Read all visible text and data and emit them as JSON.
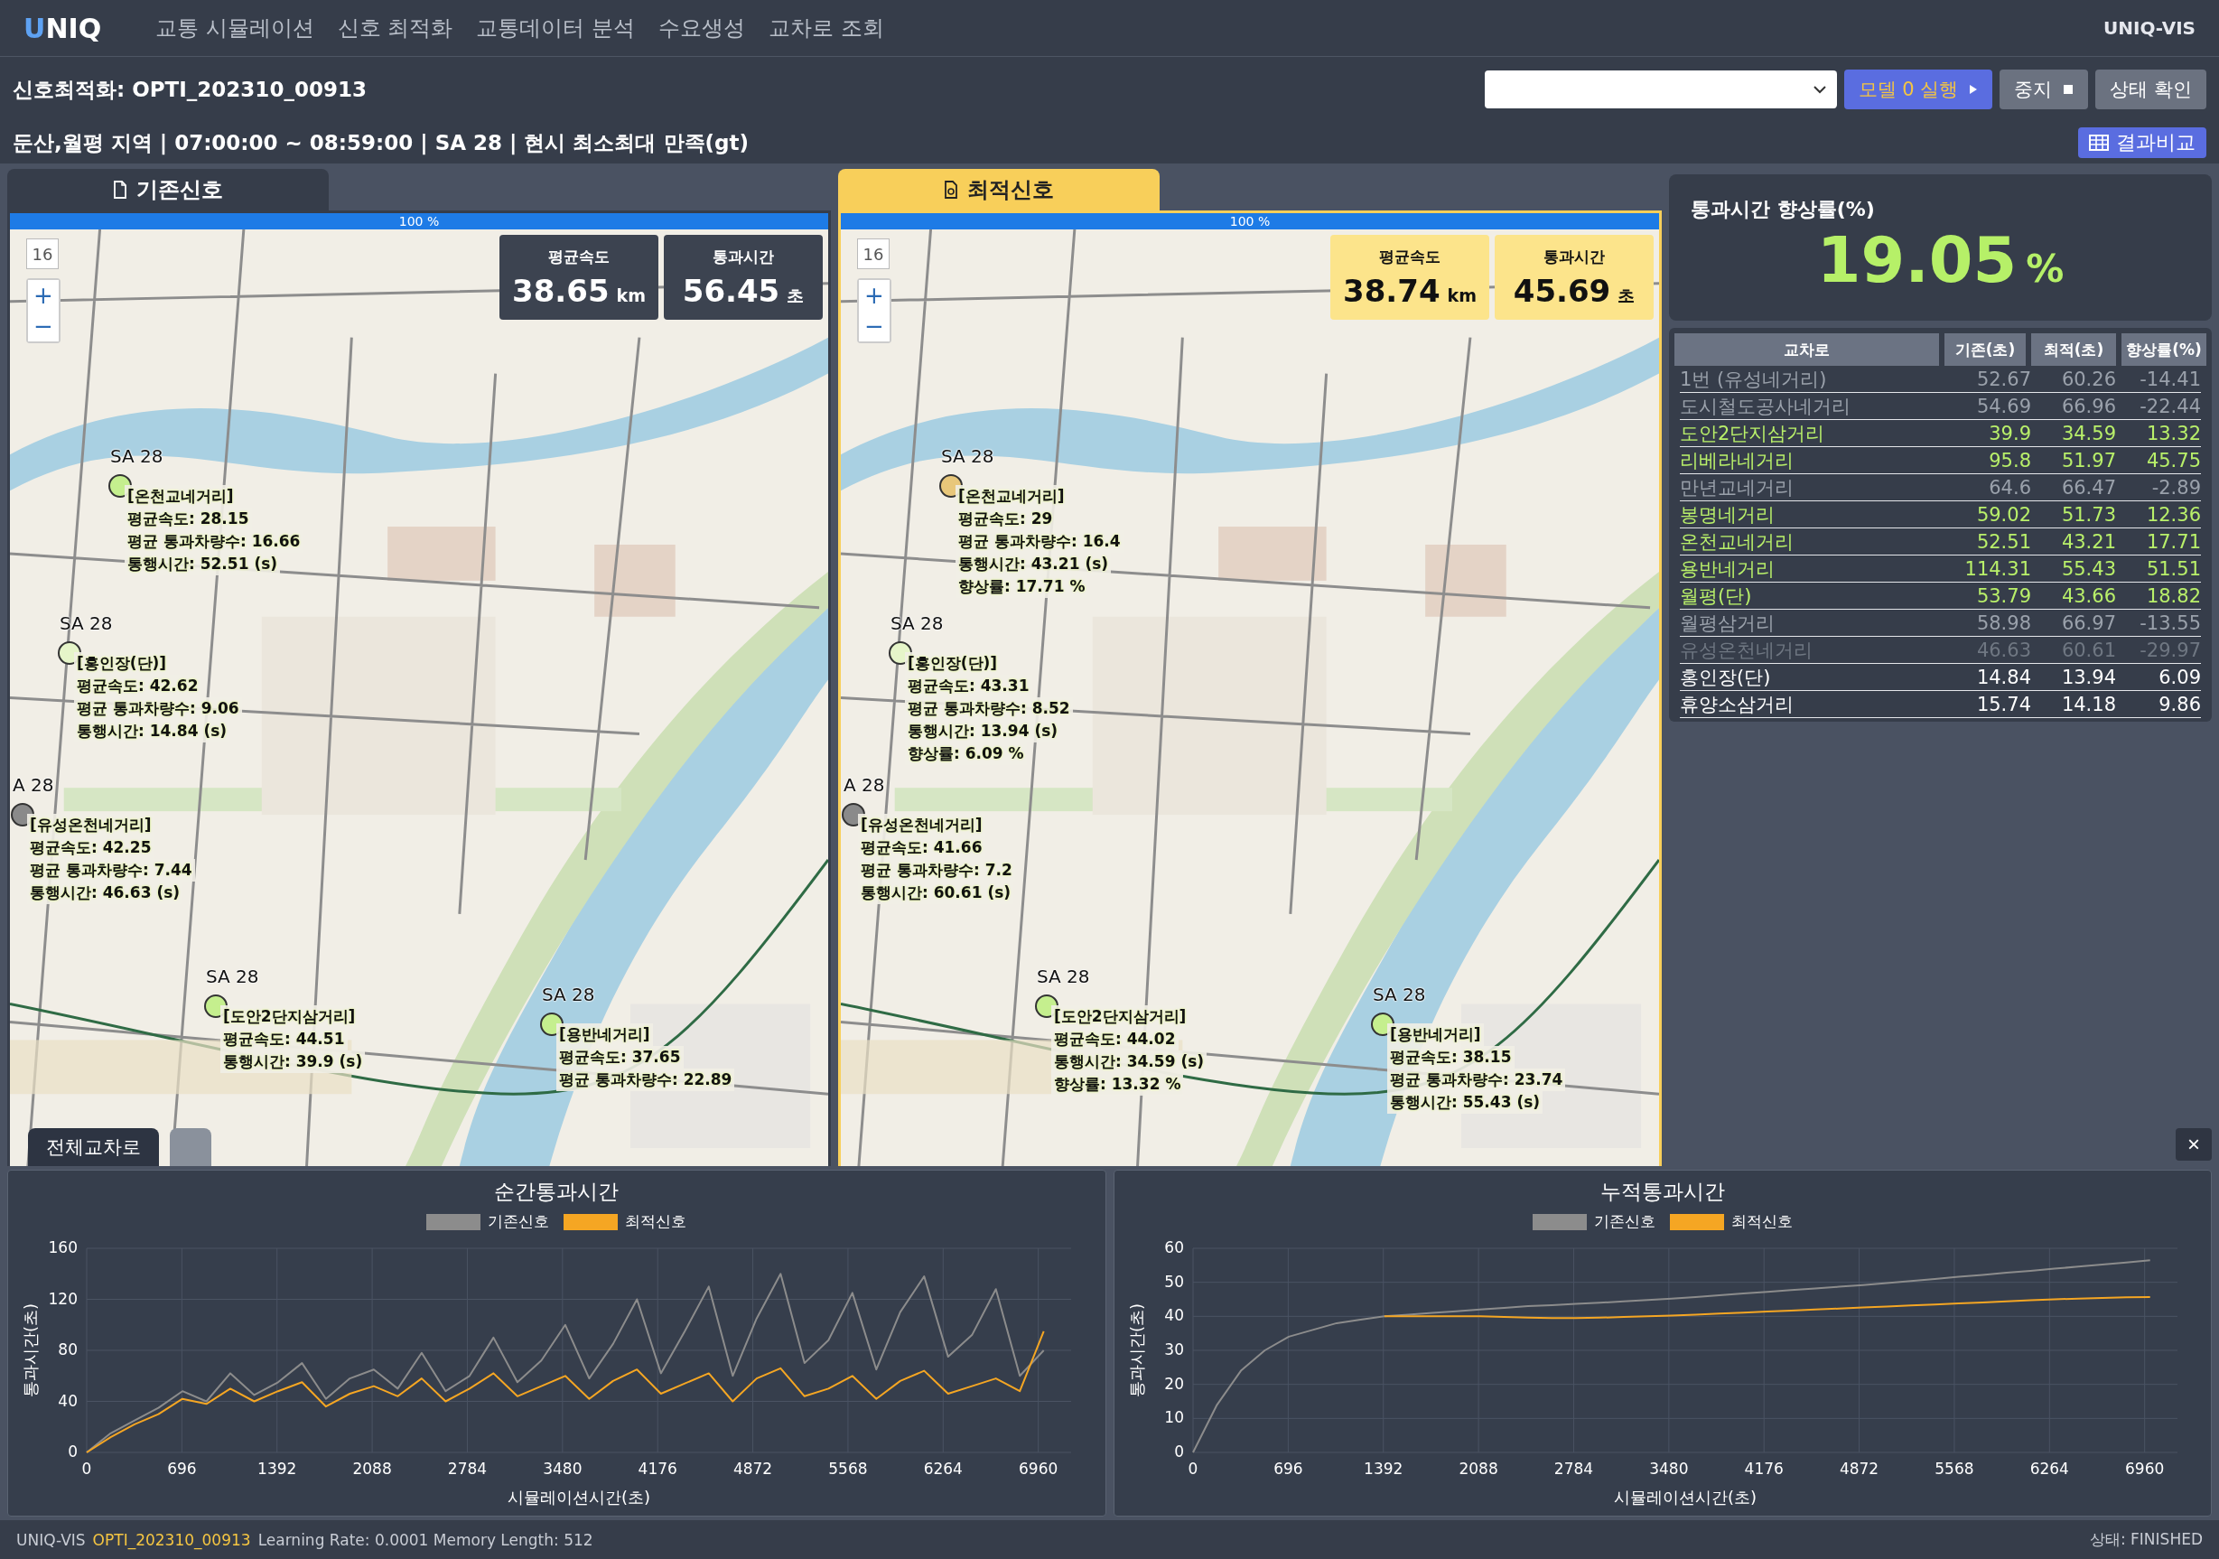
{
  "nav": {
    "logo_accent": "U",
    "logo_rest": "NIQ",
    "items": [
      "교통 시뮬레이션",
      "신호 최적화",
      "교통데이터 분석",
      "수요생성",
      "교차로 조회"
    ],
    "brand": "UNIQ-VIS"
  },
  "toolbar": {
    "title": "신호최적화: OPTI_202310_00913",
    "buttons": [
      {
        "label": "모델 0 실행",
        "kind": "run"
      },
      {
        "label": "중지",
        "kind": "stop"
      },
      {
        "label": "상태 확인",
        "kind": "plain"
      }
    ]
  },
  "info": {
    "text": "둔산,월평 지역 | 07:00:00 ~ 08:59:00 | SA 28 | 현시 최소최대 만족(gt)",
    "button": "결과비교"
  },
  "maps": [
    {
      "kind": "base",
      "tab": "기존신호",
      "progress": {
        "label": "100 %",
        "level": 1
      },
      "zoom_level": "16",
      "zoom_in": "+",
      "zoom_out": "−",
      "stats": [
        {
          "label": "평균속도",
          "value": "38.65",
          "unit": "km"
        },
        {
          "label": "통과시간",
          "value": "56.45",
          "unit": "초"
        }
      ],
      "markers": [
        {
          "sa": "SA 28",
          "name": "[온천교네거리]",
          "color": "#c5ef8e",
          "lines": [
            "평균속도: 28.15",
            "평균 통과차량수: 16.66",
            "통행시간: 52.51 (s)"
          ]
        },
        {
          "sa": "SA 28",
          "name": "[홍인장(단)]",
          "color": "#e6f5c9",
          "lines": [
            "평균속도: 42.62",
            "평균 통과차량수: 9.06",
            "통행시간: 14.84 (s)"
          ]
        },
        {
          "sa": "A 28",
          "name": "[유성온천네거리]",
          "color": "#8a8a8a",
          "lines": [
            "평균속도: 42.25",
            "평균 통과차량수: 7.44",
            "통행시간: 46.63 (s)"
          ]
        },
        {
          "sa": "SA 28",
          "name": "[도안2단지삼거리]",
          "color": "#c5ef8e",
          "lines": [
            "평균속도: 44.51",
            "통행시간: 39.9 (s)"
          ]
        },
        {
          "sa": "SA 28",
          "name": "[용반네거리]",
          "color": "#c5ef8e",
          "lines": [
            "평균속도: 37.65",
            "평균 통과차량수: 22.89"
          ]
        }
      ],
      "bottom_tabs": [
        {
          "label": "전체교차로",
          "selected": true
        },
        {
          "selected": false
        }
      ]
    },
    {
      "kind": "optimal",
      "tab": "최적신호",
      "progress": {
        "label": "100 %",
        "level": 1
      },
      "zoom_level": "16",
      "zoom_in": "+",
      "zoom_out": "−",
      "stats": [
        {
          "label": "평균속도",
          "value": "38.74",
          "unit": "km"
        },
        {
          "label": "통과시간",
          "value": "45.69",
          "unit": "초"
        }
      ],
      "markers": [
        {
          "sa": "SA 28",
          "name": "[온천교네거리]",
          "color": "#e8c77a",
          "lines": [
            "평균속도: 29",
            "평균 통과차량수: 16.4",
            "통행시간: 43.21 (s)",
            "향상률: 17.71 %"
          ]
        },
        {
          "sa": "SA 28",
          "name": "[홍인장(단)]",
          "color": "#e6f5c9",
          "lines": [
            "평균속도: 43.31",
            "평균 통과차량수: 8.52",
            "통행시간: 13.94 (s)",
            "향상률: 6.09 %"
          ]
        },
        {
          "sa": "A 28",
          "name": "[유성온천네거리]",
          "color": "#8a8a8a",
          "lines": [
            "평균속도: 41.66",
            "평균 통과차량수: 7.2",
            "통행시간: 60.61 (s)"
          ]
        },
        {
          "sa": "SA 28",
          "name": "[도안2단지삼거리]",
          "color": "#c5ef8e",
          "lines": [
            "평균속도: 44.02",
            "통행시간: 34.59 (s)",
            "향상률: 13.32 %"
          ]
        },
        {
          "sa": "SA 28",
          "name": "[용반네거리]",
          "color": "#c5ef8e",
          "lines": [
            "평균속도: 38.15",
            "평균 통과차량수: 23.74",
            "통행시간: 55.43 (s)"
          ]
        }
      ]
    }
  ],
  "close": "×",
  "summary": {
    "title": "통과시간 향상률(%)",
    "value": "19.05",
    "unit": "%"
  },
  "table": {
    "columns": [
      "교차로",
      "기존(초)",
      "최적(초)",
      "향상률(%)"
    ],
    "rows": [
      {
        "kind": "worse",
        "cells": [
          "1번 (유성네거리)",
          "52.67",
          "60.26",
          "-14.41"
        ]
      },
      {
        "kind": "worse",
        "cells": [
          "도시철도공사네거리",
          "54.69",
          "66.96",
          "-22.44"
        ]
      },
      {
        "kind": "better",
        "cells": [
          "도안2단지삼거리",
          "39.9",
          "34.59",
          "13.32"
        ]
      },
      {
        "kind": "better",
        "cells": [
          "리베라네거리",
          "95.8",
          "51.97",
          "45.75"
        ]
      },
      {
        "kind": "worse",
        "cells": [
          "만년교네거리",
          "64.6",
          "66.47",
          "-2.89"
        ]
      },
      {
        "kind": "better",
        "cells": [
          "봉명네거리",
          "59.02",
          "51.73",
          "12.36"
        ]
      },
      {
        "kind": "better",
        "cells": [
          "온천교네거리",
          "52.51",
          "43.21",
          "17.71"
        ]
      },
      {
        "kind": "better",
        "cells": [
          "용반네거리",
          "114.31",
          "55.43",
          "51.51"
        ]
      },
      {
        "kind": "better",
        "cells": [
          "월평(단)",
          "53.79",
          "43.66",
          "18.82"
        ]
      },
      {
        "kind": "worse",
        "cells": [
          "월평삼거리",
          "58.98",
          "66.97",
          "-13.55"
        ]
      },
      {
        "kind": "muted",
        "cells": [
          "유성온천네거리",
          "46.63",
          "60.61",
          "-29.97"
        ]
      },
      {
        "kind": "plain",
        "cells": [
          "홍인장(단)",
          "14.84",
          "13.94",
          "6.09"
        ]
      },
      {
        "kind": "plain",
        "cells": [
          "휴양소삼거리",
          "15.74",
          "14.18",
          "9.86"
        ]
      }
    ]
  },
  "charts": [
    {
      "chart_data": {
        "type": "line",
        "grid": true,
        "title": "순간통과시간",
        "xlabel": "시뮬레이션시간(초)",
        "ylabel": "통과시간(초)",
        "xlim": [
          0,
          7200
        ],
        "ylim": [
          0,
          160
        ],
        "xticks": [
          0,
          696,
          1392,
          2088,
          2784,
          3480,
          4176,
          4872,
          5568,
          6264,
          6960
        ],
        "yticks": [
          0,
          40,
          80,
          120,
          160
        ],
        "x": [
          0,
          175,
          350,
          525,
          700,
          875,
          1050,
          1225,
          1400,
          1575,
          1750,
          1925,
          2100,
          2275,
          2450,
          2625,
          2800,
          2975,
          3150,
          3325,
          3500,
          3675,
          3850,
          4025,
          4200,
          4375,
          4550,
          4725,
          4900,
          5075,
          5250,
          5425,
          5600,
          5775,
          5950,
          6125,
          6300,
          6475,
          6650,
          6825,
          7000
        ],
        "series": [
          {
            "name": "기존신호",
            "color": "#8c8c8c",
            "values": [
              0,
              15,
              25,
              35,
              48,
              40,
              62,
              45,
              55,
              70,
              42,
              58,
              65,
              50,
              78,
              48,
              60,
              90,
              55,
              72,
              100,
              58,
              85,
              120,
              62,
              95,
              130,
              60,
              105,
              140,
              70,
              88,
              125,
              65,
              110,
              138,
              75,
              92,
              128,
              60,
              80
            ]
          },
          {
            "name": "최적신호",
            "color": "#f5a623",
            "values": [
              0,
              12,
              22,
              30,
              42,
              38,
              50,
              40,
              48,
              55,
              36,
              46,
              52,
              44,
              58,
              40,
              50,
              62,
              44,
              52,
              60,
              42,
              56,
              65,
              46,
              54,
              62,
              40,
              58,
              66,
              44,
              50,
              60,
              42,
              56,
              64,
              46,
              52,
              58,
              48,
              95
            ]
          }
        ]
      }
    },
    {
      "chart_data": {
        "type": "line",
        "grid": true,
        "title": "누적통과시간",
        "xlabel": "시뮬레이션시간(초)",
        "ylabel": "통과시간(초)",
        "xlim": [
          0,
          7200
        ],
        "ylim": [
          0,
          60
        ],
        "xticks": [
          0,
          696,
          1392,
          2088,
          2784,
          3480,
          4176,
          4872,
          5568,
          6264,
          6960
        ],
        "yticks": [
          0,
          10,
          20,
          30,
          40,
          50,
          60
        ],
        "x": [
          0,
          175,
          350,
          525,
          700,
          875,
          1050,
          1225,
          1400,
          1575,
          1750,
          1925,
          2100,
          2275,
          2450,
          2625,
          2800,
          2975,
          3150,
          3325,
          3500,
          3675,
          3850,
          4025,
          4200,
          4375,
          4550,
          4725,
          4900,
          5075,
          5250,
          5425,
          5600,
          5775,
          5950,
          6125,
          6300,
          6475,
          6650,
          6825,
          7000
        ],
        "series": [
          {
            "name": "기존신호",
            "color": "#8c8c8c",
            "values": [
              0,
              14,
              24,
              30,
              34,
              36,
              38,
              39,
              40,
              40.5,
              41,
              41.5,
              42,
              42.5,
              43,
              43.3,
              43.7,
              44,
              44.4,
              44.8,
              45.2,
              45.7,
              46.2,
              46.7,
              47.2,
              47.7,
              48.2,
              48.7,
              49.2,
              49.8,
              50.4,
              51,
              51.6,
              52.2,
              52.8,
              53.4,
              54,
              54.6,
              55.2,
              55.8,
              56.5
            ]
          },
          {
            "name": "최적신호",
            "color": "#f5a623",
            "values": [
              null,
              null,
              null,
              null,
              null,
              null,
              null,
              null,
              40,
              40,
              40,
              40,
              40,
              39.8,
              39.6,
              39.5,
              39.5,
              39.6,
              39.8,
              40,
              40.2,
              40.5,
              40.8,
              41.1,
              41.4,
              41.7,
              42,
              42.3,
              42.6,
              42.9,
              43.2,
              43.5,
              43.8,
              44.1,
              44.4,
              44.7,
              45,
              45.2,
              45.4,
              45.6,
              45.7
            ]
          }
        ]
      }
    }
  ],
  "footer": {
    "app": "UNIQ-VIS",
    "run_id": "OPTI_202310_00913",
    "params": "Learning Rate: 0.0001 Memory Length: 512",
    "status": "상태: FINISHED"
  }
}
